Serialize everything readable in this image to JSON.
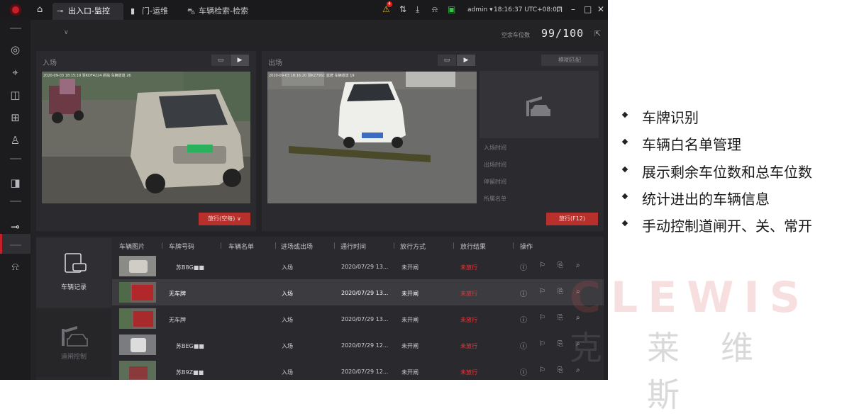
{
  "topbar": {
    "tabs": [
      {
        "label": "出入口-监控",
        "icon": "barrier-icon"
      },
      {
        "label": "门-运维",
        "icon": "door-icon"
      },
      {
        "label": "车辆检索-检索",
        "icon": "car-icon"
      }
    ],
    "alert_count": "4",
    "user": "admin",
    "clock": "18:16:37 UTC+08:00"
  },
  "header": {
    "free_spaces_label": "空余车位数",
    "free_spaces_value": "99/100"
  },
  "entry_panel": {
    "title": "入场",
    "timestamp": "2020-09-03 18:15:19 浙KDF4224 抓拍 车辆道道 26",
    "open_button": "放行(空每)"
  },
  "exit_panel": {
    "title": "出场",
    "timestamp": "2020-09-03 18:16:20 浙KZ79SC 蓝牌 车辆道道 19",
    "fuzzy_match_button": "模糊匹配",
    "labels": [
      "入场时间",
      "出场时间",
      "停留时间",
      "所属名单"
    ],
    "open_button": "放行(F12)"
  },
  "left_tabs": [
    {
      "label": "车辆记录",
      "active": true
    },
    {
      "label": "道闸控制",
      "active": false
    }
  ],
  "table": {
    "columns": [
      "车辆图片",
      "车牌号码",
      "车辆名单",
      "进场或出场",
      "通行时间",
      "放行方式",
      "放行结果",
      "操作"
    ],
    "rows": [
      {
        "plate": "苏B8G■■",
        "direction": "入场",
        "time": "2020/07/29 13...",
        "mode": "未开闸",
        "result": "未放行"
      },
      {
        "plate": "无车牌",
        "direction": "入场",
        "time": "2020/07/29 13...",
        "mode": "未开闸",
        "result": "未放行"
      },
      {
        "plate": "无车牌",
        "direction": "入场",
        "time": "2020/07/29 13...",
        "mode": "未开闸",
        "result": "未放行"
      },
      {
        "plate": "苏BEG■■",
        "direction": "入场",
        "time": "2020/07/29 12...",
        "mode": "未开闸",
        "result": "未放行"
      },
      {
        "plate": "苏B9Z■■",
        "direction": "入场",
        "time": "2020/07/29 12...",
        "mode": "未开闸",
        "result": "未放行"
      }
    ]
  },
  "slide": {
    "bullets": [
      "车牌识别",
      "车辆白名单管理",
      "展示剩余车位数和总车位数",
      "统计进出的车辆信息",
      "手动控制道闸开、关、常开"
    ]
  },
  "watermark": {
    "brand": "CLEWIS",
    "cn_left": "克",
    "cn_right": "莱维斯"
  },
  "colors": {
    "accent": "#c3202a",
    "status_red": "#e5383b",
    "panel": "#2b2b2f"
  }
}
